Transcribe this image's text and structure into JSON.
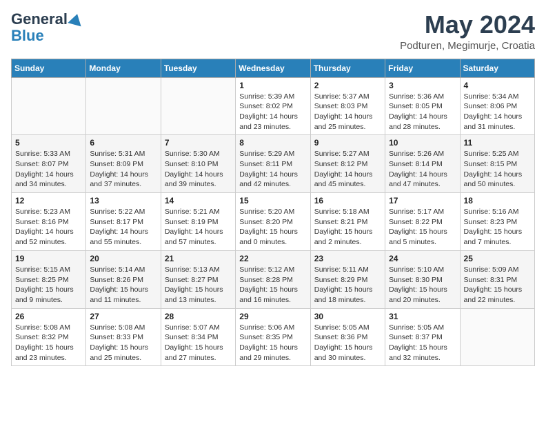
{
  "header": {
    "logo_general": "General",
    "logo_blue": "Blue",
    "month_title": "May 2024",
    "location": "Podturen, Megimurje, Croatia"
  },
  "days_of_week": [
    "Sunday",
    "Monday",
    "Tuesday",
    "Wednesday",
    "Thursday",
    "Friday",
    "Saturday"
  ],
  "weeks": [
    [
      {
        "day": "",
        "info": ""
      },
      {
        "day": "",
        "info": ""
      },
      {
        "day": "",
        "info": ""
      },
      {
        "day": "1",
        "info": "Sunrise: 5:39 AM\nSunset: 8:02 PM\nDaylight: 14 hours\nand 23 minutes."
      },
      {
        "day": "2",
        "info": "Sunrise: 5:37 AM\nSunset: 8:03 PM\nDaylight: 14 hours\nand 25 minutes."
      },
      {
        "day": "3",
        "info": "Sunrise: 5:36 AM\nSunset: 8:05 PM\nDaylight: 14 hours\nand 28 minutes."
      },
      {
        "day": "4",
        "info": "Sunrise: 5:34 AM\nSunset: 8:06 PM\nDaylight: 14 hours\nand 31 minutes."
      }
    ],
    [
      {
        "day": "5",
        "info": "Sunrise: 5:33 AM\nSunset: 8:07 PM\nDaylight: 14 hours\nand 34 minutes."
      },
      {
        "day": "6",
        "info": "Sunrise: 5:31 AM\nSunset: 8:09 PM\nDaylight: 14 hours\nand 37 minutes."
      },
      {
        "day": "7",
        "info": "Sunrise: 5:30 AM\nSunset: 8:10 PM\nDaylight: 14 hours\nand 39 minutes."
      },
      {
        "day": "8",
        "info": "Sunrise: 5:29 AM\nSunset: 8:11 PM\nDaylight: 14 hours\nand 42 minutes."
      },
      {
        "day": "9",
        "info": "Sunrise: 5:27 AM\nSunset: 8:12 PM\nDaylight: 14 hours\nand 45 minutes."
      },
      {
        "day": "10",
        "info": "Sunrise: 5:26 AM\nSunset: 8:14 PM\nDaylight: 14 hours\nand 47 minutes."
      },
      {
        "day": "11",
        "info": "Sunrise: 5:25 AM\nSunset: 8:15 PM\nDaylight: 14 hours\nand 50 minutes."
      }
    ],
    [
      {
        "day": "12",
        "info": "Sunrise: 5:23 AM\nSunset: 8:16 PM\nDaylight: 14 hours\nand 52 minutes."
      },
      {
        "day": "13",
        "info": "Sunrise: 5:22 AM\nSunset: 8:17 PM\nDaylight: 14 hours\nand 55 minutes."
      },
      {
        "day": "14",
        "info": "Sunrise: 5:21 AM\nSunset: 8:19 PM\nDaylight: 14 hours\nand 57 minutes."
      },
      {
        "day": "15",
        "info": "Sunrise: 5:20 AM\nSunset: 8:20 PM\nDaylight: 15 hours\nand 0 minutes."
      },
      {
        "day": "16",
        "info": "Sunrise: 5:18 AM\nSunset: 8:21 PM\nDaylight: 15 hours\nand 2 minutes."
      },
      {
        "day": "17",
        "info": "Sunrise: 5:17 AM\nSunset: 8:22 PM\nDaylight: 15 hours\nand 5 minutes."
      },
      {
        "day": "18",
        "info": "Sunrise: 5:16 AM\nSunset: 8:23 PM\nDaylight: 15 hours\nand 7 minutes."
      }
    ],
    [
      {
        "day": "19",
        "info": "Sunrise: 5:15 AM\nSunset: 8:25 PM\nDaylight: 15 hours\nand 9 minutes."
      },
      {
        "day": "20",
        "info": "Sunrise: 5:14 AM\nSunset: 8:26 PM\nDaylight: 15 hours\nand 11 minutes."
      },
      {
        "day": "21",
        "info": "Sunrise: 5:13 AM\nSunset: 8:27 PM\nDaylight: 15 hours\nand 13 minutes."
      },
      {
        "day": "22",
        "info": "Sunrise: 5:12 AM\nSunset: 8:28 PM\nDaylight: 15 hours\nand 16 minutes."
      },
      {
        "day": "23",
        "info": "Sunrise: 5:11 AM\nSunset: 8:29 PM\nDaylight: 15 hours\nand 18 minutes."
      },
      {
        "day": "24",
        "info": "Sunrise: 5:10 AM\nSunset: 8:30 PM\nDaylight: 15 hours\nand 20 minutes."
      },
      {
        "day": "25",
        "info": "Sunrise: 5:09 AM\nSunset: 8:31 PM\nDaylight: 15 hours\nand 22 minutes."
      }
    ],
    [
      {
        "day": "26",
        "info": "Sunrise: 5:08 AM\nSunset: 8:32 PM\nDaylight: 15 hours\nand 23 minutes."
      },
      {
        "day": "27",
        "info": "Sunrise: 5:08 AM\nSunset: 8:33 PM\nDaylight: 15 hours\nand 25 minutes."
      },
      {
        "day": "28",
        "info": "Sunrise: 5:07 AM\nSunset: 8:34 PM\nDaylight: 15 hours\nand 27 minutes."
      },
      {
        "day": "29",
        "info": "Sunrise: 5:06 AM\nSunset: 8:35 PM\nDaylight: 15 hours\nand 29 minutes."
      },
      {
        "day": "30",
        "info": "Sunrise: 5:05 AM\nSunset: 8:36 PM\nDaylight: 15 hours\nand 30 minutes."
      },
      {
        "day": "31",
        "info": "Sunrise: 5:05 AM\nSunset: 8:37 PM\nDaylight: 15 hours\nand 32 minutes."
      },
      {
        "day": "",
        "info": ""
      }
    ]
  ]
}
